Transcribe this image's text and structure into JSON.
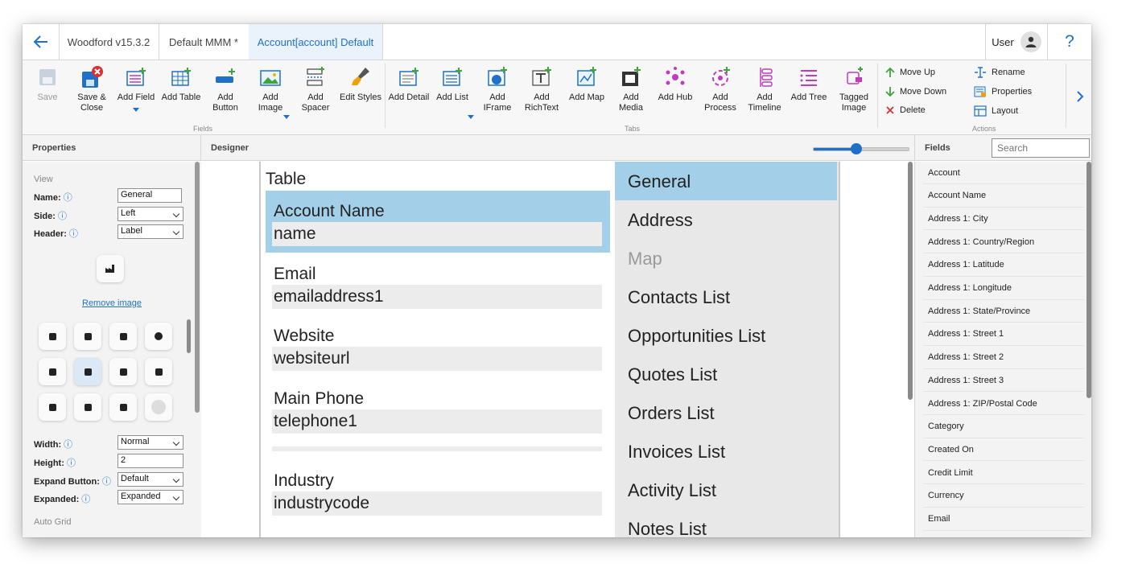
{
  "titlebar": {
    "app_tab": "Woodford v15.3.2",
    "project_tab": "Default MMM *",
    "form_tab": "Account[account] Default",
    "user": "User",
    "help": "?"
  },
  "ribbon": {
    "save": "Save",
    "save_close": [
      "Save &",
      "Close"
    ],
    "add_field": "Add Field",
    "add_table": "Add Table",
    "add_button": [
      "Add",
      "Button"
    ],
    "add_image": [
      "Add",
      "Image"
    ],
    "add_spacer": [
      "Add",
      "Spacer"
    ],
    "edit_styles": "Edit Styles",
    "fields_group": "Fields",
    "add_detail": "Add Detail",
    "add_list": "Add List",
    "add_iframe": [
      "Add",
      "IFrame"
    ],
    "add_richtext": [
      "Add",
      "RichText"
    ],
    "add_map": "Add Map",
    "add_media": [
      "Add",
      "Media"
    ],
    "add_hub": "Add Hub",
    "add_process": [
      "Add",
      "Process"
    ],
    "add_timeline": [
      "Add",
      "Timeline"
    ],
    "add_tree": "Add Tree",
    "tagged_image": [
      "Tagged",
      "Image"
    ],
    "tabs_group": "Tabs",
    "move_up": "Move Up",
    "move_down": "Move Down",
    "delete": "Delete",
    "rename": "Rename",
    "properties": "Properties",
    "layout": "Layout",
    "actions_group": "Actions"
  },
  "panes": {
    "properties": "Properties",
    "designer": "Designer",
    "fields": "Fields",
    "search_placeholder": "Search",
    "zoom_level": 0.45
  },
  "properties": {
    "view_label": "View",
    "name_label": "Name:",
    "name_value": "General",
    "side_label": "Side:",
    "side_value": "Left",
    "header_label": "Header:",
    "header_value": "Label",
    "remove_image": "Remove image",
    "width_label": "Width:",
    "width_value": "Normal",
    "height_label": "Height:",
    "height_value": "2",
    "expand_button_label": "Expand Button:",
    "expand_button_value": "Default",
    "expanded_label": "Expanded:",
    "expanded_value": "Expanded",
    "auto_grid_label": "Auto Grid",
    "info_icon": "ⓘ",
    "icon_names": [
      "folder-icon",
      "building-icon",
      "attachment-icon",
      "chart-icon",
      "document-icon",
      "factory-icon",
      "bug-icon",
      "box-icon",
      "calculator-icon",
      "doc-list-icon",
      "package-icon",
      "more-icon"
    ]
  },
  "designer": {
    "table_label": "Table",
    "fields": [
      {
        "label": "Account Name",
        "value": "name"
      },
      {
        "label": "Email",
        "value": "emailaddress1"
      },
      {
        "label": "Website",
        "value": "websiteurl"
      },
      {
        "label": "Main Phone",
        "value": "telephone1"
      },
      {
        "label": "Industry",
        "value": "industrycode"
      }
    ],
    "tabs": [
      "General",
      "Address",
      "Map",
      "Contacts List",
      "Opportunities List",
      "Quotes List",
      "Orders List",
      "Invoices List",
      "Activity List",
      "Notes List"
    ],
    "selected_color": "#a3d0e8"
  },
  "field_list": [
    "Account",
    "Account Name",
    "Address 1: City",
    "Address 1: Country/Region",
    "Address 1: Latitude",
    "Address 1: Longitude",
    "Address 1: State/Province",
    "Address 1: Street 1",
    "Address 1: Street 2",
    "Address 1: Street 3",
    "Address 1: ZIP/Postal Code",
    "Category",
    "Created On",
    "Credit Limit",
    "Currency",
    "Email"
  ],
  "colors": {
    "accent": "#1e70c8",
    "green": "#3fa33f",
    "magenta": "#c03bc0",
    "red": "#d63030"
  }
}
